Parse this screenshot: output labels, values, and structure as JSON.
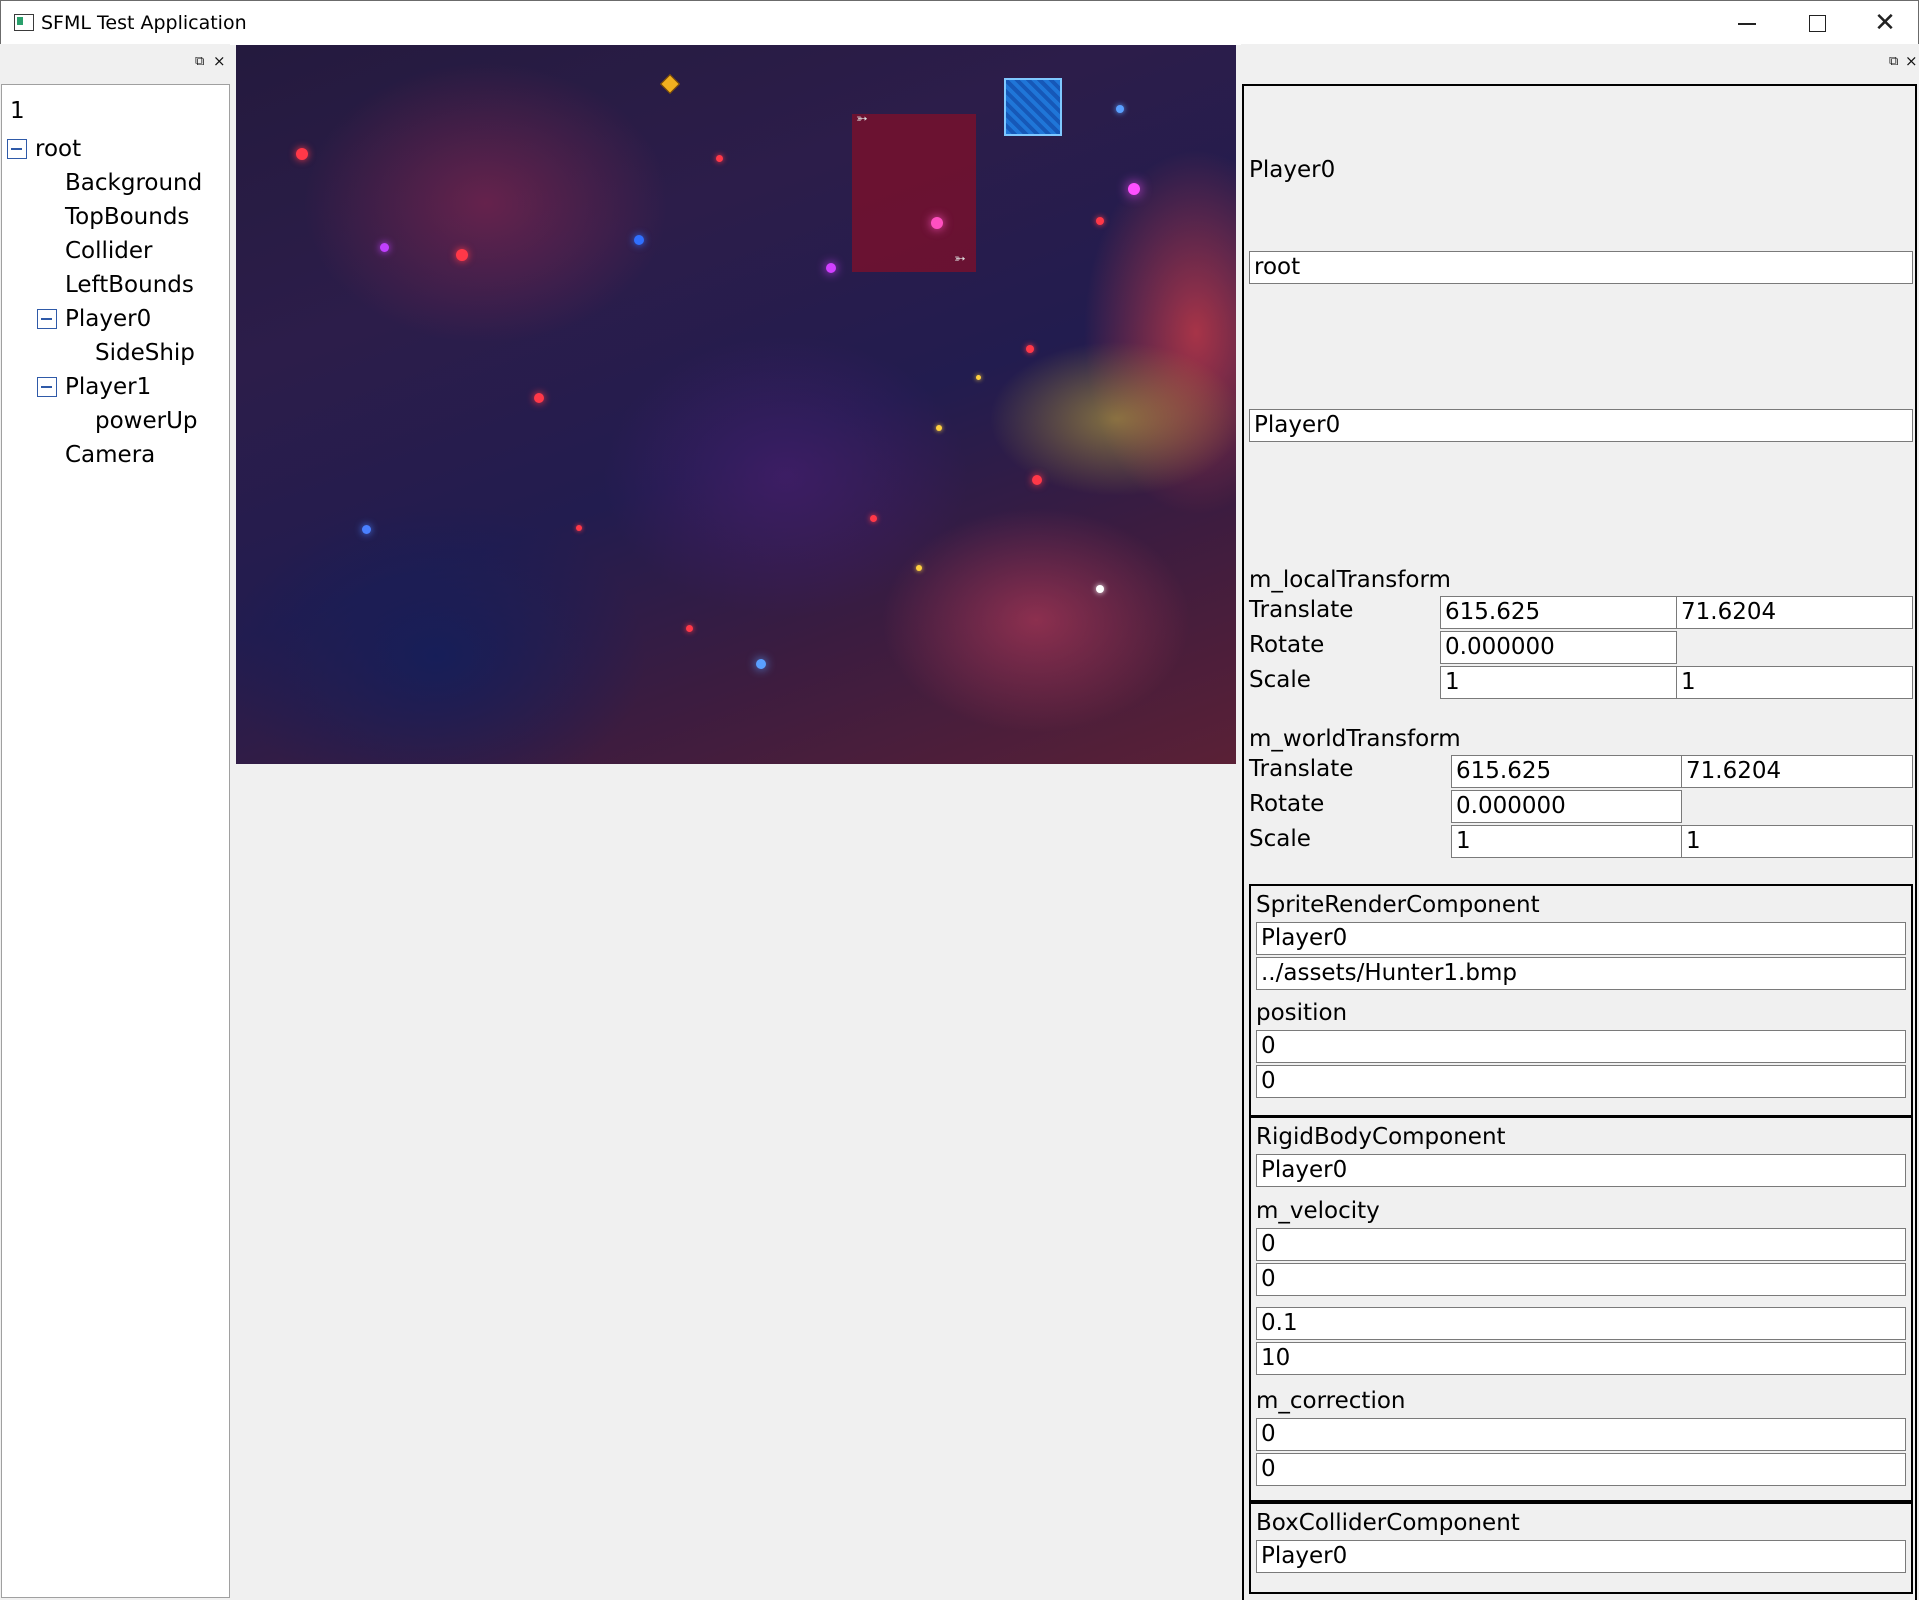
{
  "window": {
    "title": "SFML Test Application"
  },
  "dock_controls": {
    "float": "⧉",
    "close": "×"
  },
  "tree": {
    "count": "1",
    "nodes": [
      {
        "label": "root",
        "expanded": true
      },
      {
        "label": "Background"
      },
      {
        "label": "TopBounds"
      },
      {
        "label": "Collider"
      },
      {
        "label": "LeftBounds"
      },
      {
        "label": "Player0",
        "expanded": true
      },
      {
        "label": "SideShip"
      },
      {
        "label": "Player1",
        "expanded": true
      },
      {
        "label": "powerUp"
      },
      {
        "label": "Camera"
      }
    ]
  },
  "inspector": {
    "heading": "Player0",
    "parent_field": "root",
    "name_field": "Player0",
    "local_transform": {
      "title": "m_localTransform",
      "translate_label": "Translate",
      "translate_x": "615.625",
      "translate_y": "71.6204",
      "rotate_label": "Rotate",
      "rotate": "0.000000",
      "scale_label": "Scale",
      "scale_x": "1",
      "scale_y": "1"
    },
    "world_transform": {
      "title": "m_worldTransform",
      "translate_label": "Translate",
      "translate_x": "615.625",
      "translate_y": "71.6204",
      "rotate_label": "Rotate",
      "rotate": "0.000000",
      "scale_label": "Scale",
      "scale_x": "1",
      "scale_y": "1"
    },
    "sprite_render": {
      "title": "SpriteRenderComponent",
      "owner": "Player0",
      "path": "../assets/Hunter1.bmp",
      "position_label": "position",
      "position_x": "0",
      "position_y": "0"
    },
    "rigid_body": {
      "title": "RigidBodyComponent",
      "owner": "Player0",
      "velocity_label": "m_velocity",
      "velocity_x": "0",
      "velocity_y": "0",
      "value_a": "0.1",
      "value_b": "10",
      "correction_label": "m_correction",
      "correction_x": "0",
      "correction_y": "0"
    },
    "box_collider": {
      "title": "BoxColliderComponent",
      "owner": "Player0"
    }
  }
}
